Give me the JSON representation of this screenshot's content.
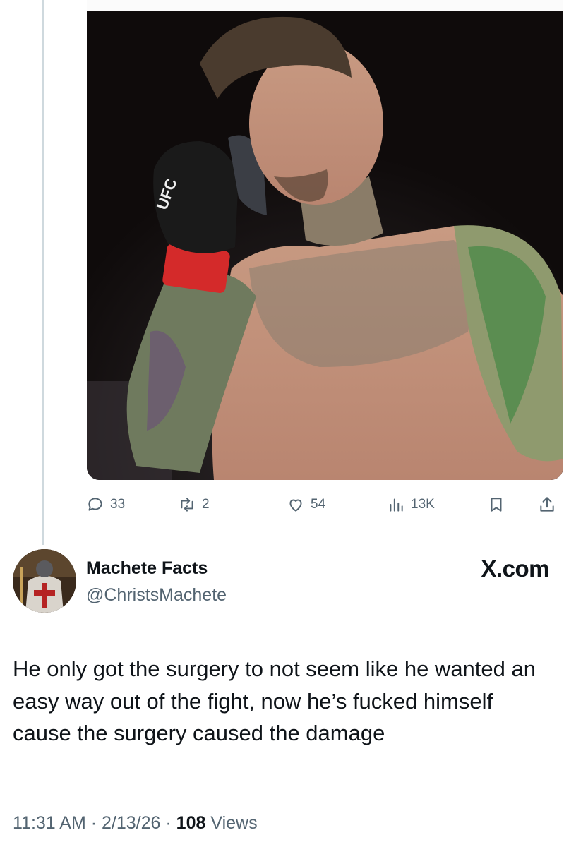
{
  "tweet_actions": {
    "replies": "33",
    "reposts": "2",
    "likes": "54",
    "views": "13K"
  },
  "author": {
    "name": "Machete Facts",
    "handle": "@ChristsMachete"
  },
  "site_mark": "X.com",
  "tweet": {
    "text": "He only got the surgery to not seem like he wanted an easy way out of the fight, now he’s fucked himself cause the surgery caused the damage",
    "time": "11:31 AM",
    "separator": "·",
    "date": "2/13/26",
    "views_count": "108",
    "views_label": "Views"
  },
  "media": {
    "glove_logo": "UFC"
  },
  "colors": {
    "text_primary": "#0f1419",
    "text_secondary": "#536471",
    "divider": "#cfd9de"
  },
  "icons": [
    "reply-icon",
    "retweet-icon",
    "heart-icon",
    "analytics-icon",
    "bookmark-icon",
    "share-icon"
  ]
}
